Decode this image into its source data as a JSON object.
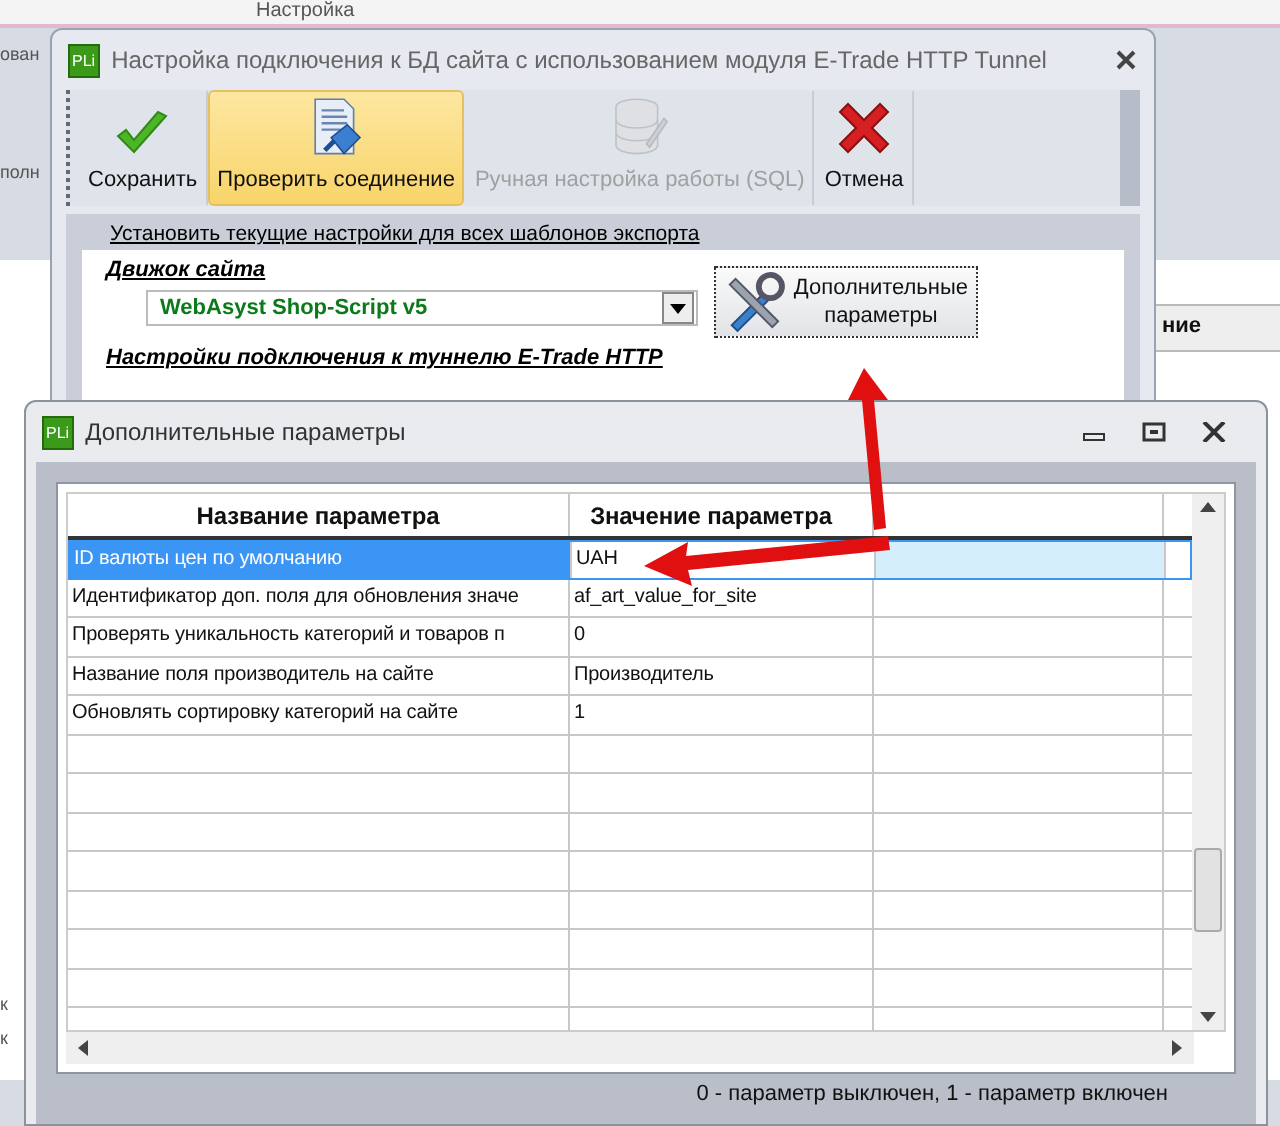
{
  "background_app": {
    "tab_title": "Настройка",
    "left_fragments": [
      "ован",
      "полн"
    ],
    "right_header": "ние",
    "bottom_fragments": [
      "к",
      "к"
    ]
  },
  "main_dialog": {
    "logo": "PLi",
    "title": "Настройка подключения к БД сайта с использованием модуля E-Trade HTTP Tunnel",
    "toolbar": [
      {
        "kind": "check",
        "label": "Сохранить",
        "hovered": false,
        "disabled": false
      },
      {
        "kind": "plug",
        "label": "Проверить соединение",
        "hovered": true,
        "disabled": false
      },
      {
        "kind": "database",
        "label": "Ручная настройка работы (SQL)",
        "hovered": false,
        "disabled": true
      },
      {
        "kind": "cancel",
        "label": "Отмена",
        "hovered": false,
        "disabled": false
      }
    ],
    "apply_all_link": "Установить текущие настройки для всех шаблонов экспорта",
    "engine_label": "Движок сайта",
    "engine_value": "WebAsyst Shop-Script v5",
    "extra_button": "Дополнительные параметры",
    "tunnel_label": "Настройки подключения к туннелю E-Trade HTTP"
  },
  "params_dialog": {
    "logo": "PLi",
    "title": "Дополнительные параметры",
    "columns": [
      "Название параметра",
      "Значение параметра"
    ],
    "rows": [
      {
        "name": "ID валюты цен по умолчанию",
        "value": "UAH",
        "selected": true
      },
      {
        "name": "Идентификатор доп. поля для обновления значе",
        "value": "af_art_value_for_site",
        "selected": false
      },
      {
        "name": "Проверять уникальность категорий и товаров п",
        "value": "0",
        "selected": false
      },
      {
        "name": "Название поля производитель на сайте",
        "value": "Производитель",
        "selected": false
      },
      {
        "name": "Обновлять сортировку категорий на сайте",
        "value": "1",
        "selected": false
      }
    ],
    "status": "0 - параметр выключен, 1 - параметр включен"
  }
}
